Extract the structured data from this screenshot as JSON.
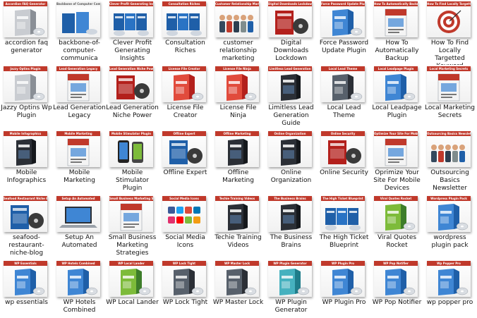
{
  "items": [
    {
      "label": "accordion faq generator",
      "banner": "Accordion FAQ Generator",
      "banner_color": "#c0392b",
      "art": "software-box-silver"
    },
    {
      "label": "backbone-of-computer-communica",
      "banner": "Backbone of Computer Communications",
      "banner_color": "#ffffff",
      "art": "book-stack"
    },
    {
      "label": "Clever Profit Generating Insights",
      "banner": "Clever Profit Generating Insights",
      "banner_color": "#c0392b",
      "art": "video-box-set"
    },
    {
      "label": "Consultation Riches",
      "banner": "Consultation Riches",
      "banner_color": "#c0392b",
      "art": "video-box-set"
    },
    {
      "label": "customer relationship marketing",
      "banner": "Customer Relationship Marketing",
      "banner_color": "#c0392b",
      "art": "people-group"
    },
    {
      "label": "Digital Downloads Lockdown",
      "banner": "Digital Downloads Lockdown",
      "banner_color": "#c0392b",
      "art": "dvd-case-red"
    },
    {
      "label": "Force Password Update Plugin",
      "banner": "Force Password Update Plugin",
      "banner_color": "#c0392b",
      "art": "software-box-blue"
    },
    {
      "label": "How To Automatically Backup",
      "banner": "How To Automatically Backup",
      "banner_color": "#c0392b",
      "art": "ebook-cover"
    },
    {
      "label": "How To Find Locally Targetted Keyword",
      "banner": "How To Find Locally Targetted Keyword",
      "banner_color": "#c0392b",
      "art": "target"
    },
    {
      "label": "Jazzy Optins Wp Plugin",
      "banner": "Jazzy Optins Plugin",
      "banner_color": "#c0392b",
      "art": "software-box-silver"
    },
    {
      "label": "Lead Generation Legacy",
      "banner": "Lead Generation Legacy",
      "banner_color": "#c0392b",
      "art": "ebook-cover"
    },
    {
      "label": "Lead Generation Niche Power",
      "banner": "Lead Generation Niche Power",
      "banner_color": "#c0392b",
      "art": "dvd-case-red"
    },
    {
      "label": "License File Creator",
      "banner": "License File Creator",
      "banner_color": "#c0392b",
      "art": "software-box-red"
    },
    {
      "label": "License File Ninja",
      "banner": "License File Ninja",
      "banner_color": "#c0392b",
      "art": "software-box-red"
    },
    {
      "label": "Limitless Lead Generation Guide",
      "banner": "Limitless Lead Generation",
      "banner_color": "#c0392b",
      "art": "book-dark"
    },
    {
      "label": "Local Lead Theme",
      "banner": "Local Lead Theme",
      "banner_color": "#c0392b",
      "art": "software-box-dark"
    },
    {
      "label": "Local Leadpage Plugin",
      "banner": "Local Leadpage Plugin",
      "banner_color": "#c0392b",
      "art": "software-box-blue"
    },
    {
      "label": "Local Marketing Secrets",
      "banner": "Local Marketing Secrets",
      "banner_color": "#c0392b",
      "art": "ebook-cover"
    },
    {
      "label": "Mobile Infographics",
      "banner": "Mobile Infographics",
      "banner_color": "#c0392b",
      "art": "book-dark"
    },
    {
      "label": "Mobile Marketing",
      "banner": "Mobile Marketing",
      "banner_color": "#c0392b",
      "art": "ebook-cover"
    },
    {
      "label": "Mobile Stimulator Plugin",
      "banner": "Mobile Stimulator Plugin",
      "banner_color": "#c0392b",
      "art": "phones"
    },
    {
      "label": "Offline Expert",
      "banner": "Offline Expert",
      "banner_color": "#c0392b",
      "art": "dvd-case-blue"
    },
    {
      "label": "Offline Marketing",
      "banner": "Offline Marketing",
      "banner_color": "#c0392b",
      "art": "book-dark"
    },
    {
      "label": "Online Organization",
      "banner": "Online Organization",
      "banner_color": "#c0392b",
      "art": "book-dark"
    },
    {
      "label": "Online Security",
      "banner": "Online Security",
      "banner_color": "#c0392b",
      "art": "dvd-case-red"
    },
    {
      "label": "Oprimize Your Site For Mobile Devices",
      "banner": "Optimize Your Site For Mobile Devices",
      "banner_color": "#c0392b",
      "art": "ebook-cover"
    },
    {
      "label": "Outsourcing Basics Newsletter",
      "banner": "Outsourcing Basics Newsletter",
      "banner_color": "#c0392b",
      "art": "people-group"
    },
    {
      "label": "seafood-restaurant-niche-blog",
      "banner": "Seafood Restaurant Niche Blog",
      "banner_color": "#c0392b",
      "art": "dvd-case-blue"
    },
    {
      "label": "Setup An Automated",
      "banner": "Setup An Automated",
      "banner_color": "#c0392b",
      "art": "laptop"
    },
    {
      "label": "Small Business Marketing Strategies",
      "banner": "Small Business Marketing Strategies",
      "banner_color": "#c0392b",
      "art": "ebook-cover"
    },
    {
      "label": "Social Media Icons",
      "banner": "Social Media Icons",
      "banner_color": "#c0392b",
      "art": "icon-grid"
    },
    {
      "label": "Techie Training Videos",
      "banner": "Techie Training Videos",
      "banner_color": "#c0392b",
      "art": "book-dark"
    },
    {
      "label": "The Business Brains",
      "banner": "The Business Brains",
      "banner_color": "#c0392b",
      "art": "book-dark"
    },
    {
      "label": "The High Ticket Blueprint",
      "banner": "The High Ticket Blueprint",
      "banner_color": "#c0392b",
      "art": "video-box-set"
    },
    {
      "label": "Viral Quotes Rocket",
      "banner": "Viral Quotes Rocket",
      "banner_color": "#c0392b",
      "art": "software-box-green"
    },
    {
      "label": "wordpress plugin pack",
      "banner": "Wordpress Plugin Pack",
      "banner_color": "#c0392b",
      "art": "software-box-blue"
    },
    {
      "label": "wp essentials",
      "banner": "WP Essentials",
      "banner_color": "#c0392b",
      "art": "software-box-blue"
    },
    {
      "label": "WP Hotels Combined",
      "banner": "WP Hotels Combined",
      "banner_color": "#c0392b",
      "art": "software-box-blue"
    },
    {
      "label": "WP Local Lander",
      "banner": "WP Local Lander",
      "banner_color": "#c0392b",
      "art": "software-box-green"
    },
    {
      "label": "WP Lock Tight",
      "banner": "WP Lock Tight",
      "banner_color": "#c0392b",
      "art": "software-box-dark"
    },
    {
      "label": "WP Master Lock",
      "banner": "WP Master Lock",
      "banner_color": "#c0392b",
      "art": "software-box-dark"
    },
    {
      "label": "WP Plugin Generator",
      "banner": "WP Plugin Generator",
      "banner_color": "#c0392b",
      "art": "software-box-teal"
    },
    {
      "label": "WP Plugin Pro",
      "banner": "WP Plugin Pro",
      "banner_color": "#c0392b",
      "art": "software-box-blue"
    },
    {
      "label": "WP Pop Notifier",
      "banner": "WP Pop Notifier",
      "banner_color": "#c0392b",
      "art": "software-box-blue"
    },
    {
      "label": "wp popper pro",
      "banner": "Wp Popper Pro",
      "banner_color": "#c0392b",
      "art": "software-box-blue"
    }
  ]
}
